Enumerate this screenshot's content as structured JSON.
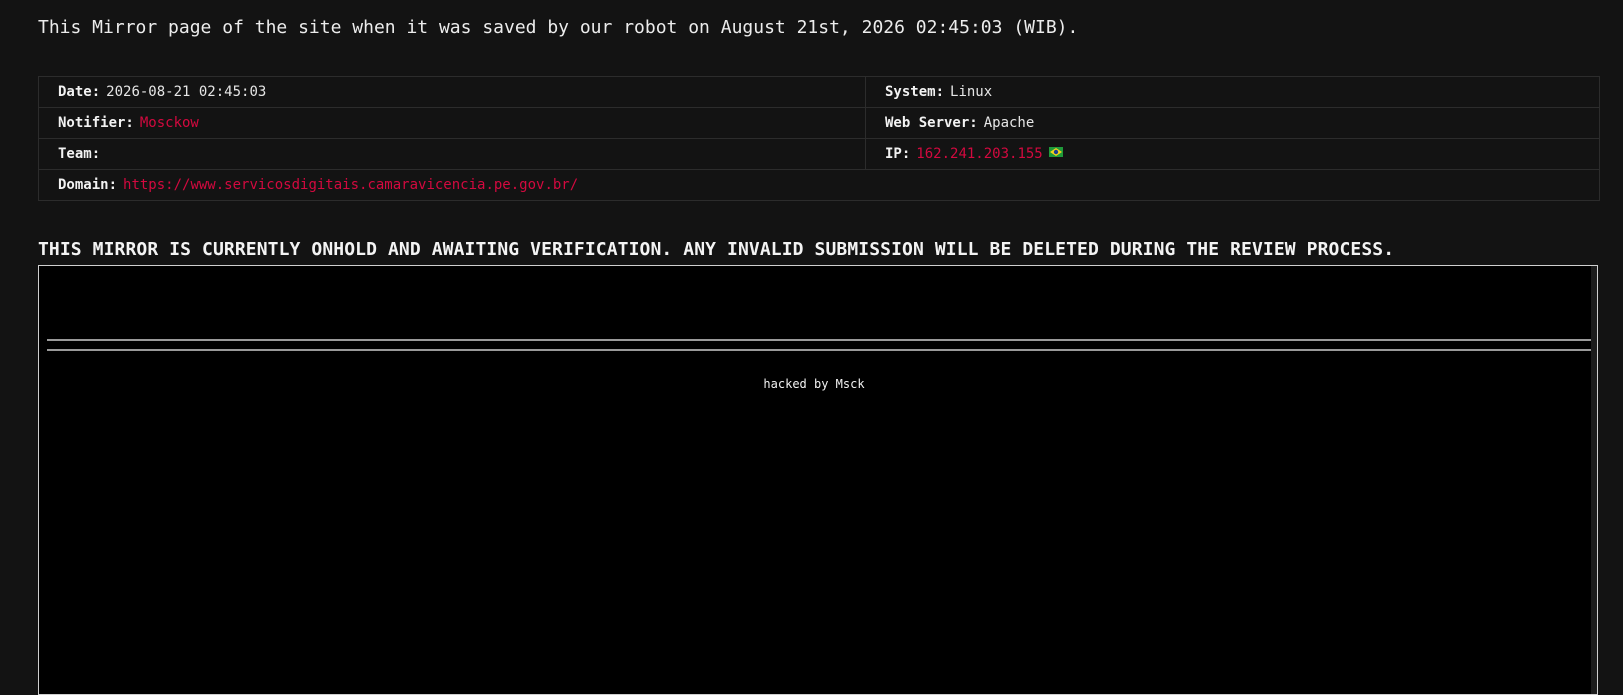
{
  "intro_text": "This Mirror page of the site when it was saved by our robot on August 21st, 2026 02:45:03 (WIB).",
  "info": {
    "date_label": "Date:",
    "date_value": "2026-08-21 02:45:03",
    "system_label": "System:",
    "system_value": "Linux",
    "notifier_label": "Notifier:",
    "notifier_value": "Mosckow",
    "webserver_label": "Web Server:",
    "webserver_value": "Apache",
    "team_label": "Team:",
    "team_value": "",
    "ip_label": "IP:",
    "ip_value": "162.241.203.155",
    "ip_flag_icon": "brazil-flag-icon",
    "domain_label": "Domain:",
    "domain_value": "https://www.servicosdigitais.camaravicencia.pe.gov.br/"
  },
  "onhold_notice": "THIS MIRROR IS CURRENTLY ONHOLD AND AWAITING VERIFICATION. ANY INVALID SUBMISSION WILL BE DELETED DURING THE REVIEW PROCESS.",
  "mirror": {
    "hacked_text": "hacked by Msck"
  },
  "colors": {
    "page_background": "#131313",
    "accent_red": "#d3093f",
    "mirror_background": "#000000"
  }
}
